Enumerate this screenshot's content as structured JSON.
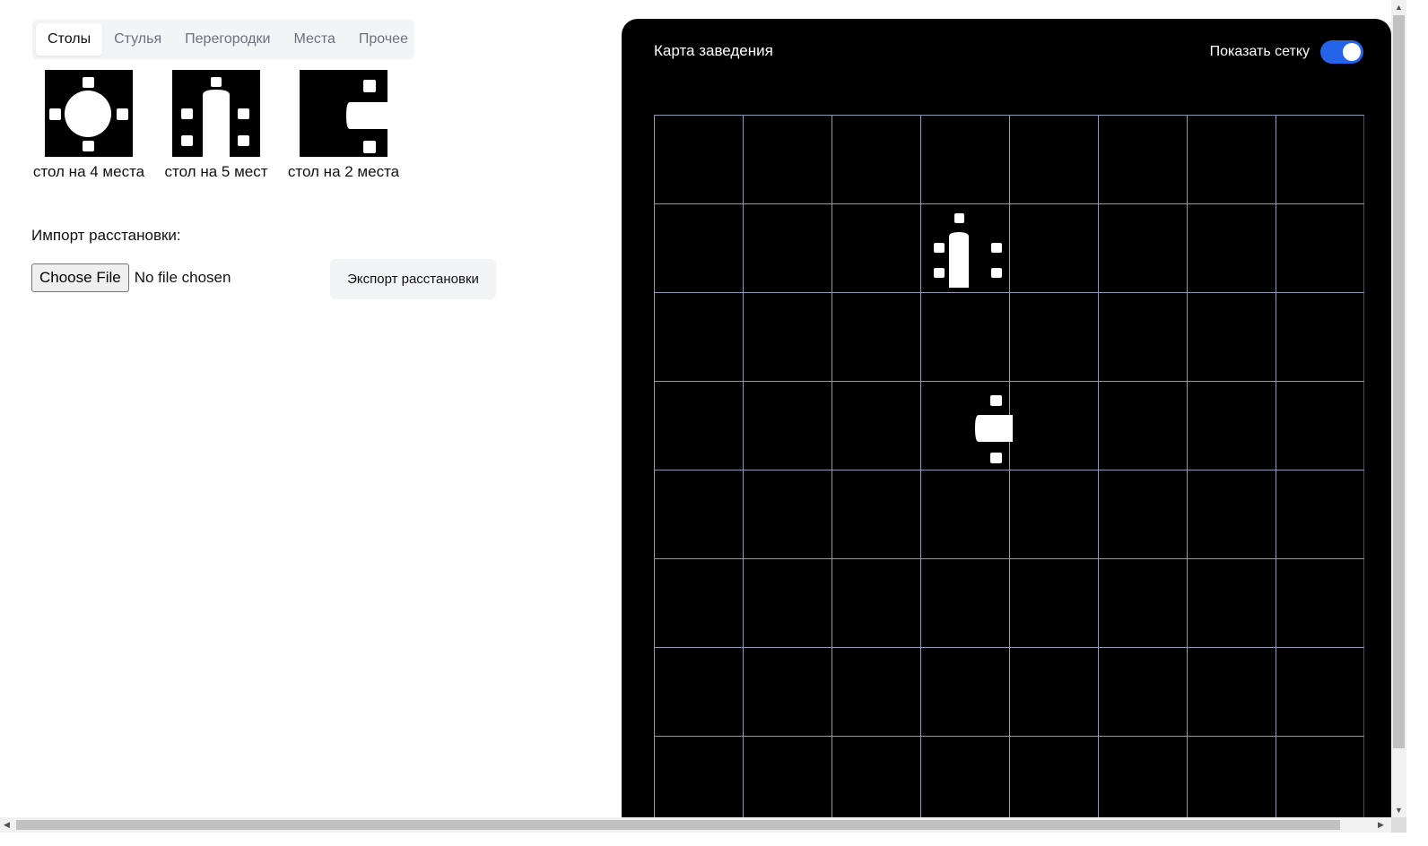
{
  "tabs": [
    {
      "label": "Столы",
      "active": true
    },
    {
      "label": "Стулья",
      "active": false
    },
    {
      "label": "Перегородки",
      "active": false
    },
    {
      "label": "Места",
      "active": false
    },
    {
      "label": "Прочее",
      "active": false
    }
  ],
  "items": [
    {
      "label": "стол на 4 места",
      "icon": "round-table-4-icon"
    },
    {
      "label": "стол на 5 мест",
      "icon": "long-table-5-icon"
    },
    {
      "label": "стол на 2 места",
      "icon": "side-table-2-icon"
    }
  ],
  "import": {
    "label": "Импорт расстановки:",
    "choose_button": "Choose File",
    "file_status": "No file chosen"
  },
  "export": {
    "button": "Экспорт расстановки"
  },
  "map": {
    "title": "Карта заведения",
    "show_grid_label": "Показать сетку",
    "show_grid": true,
    "grid_columns": 8,
    "grid_rows_visible": 8,
    "placed_items": [
      {
        "type": "long-table-5",
        "column": 4,
        "row": 2
      },
      {
        "type": "side-table-2",
        "column": 4,
        "row": 4
      }
    ]
  },
  "colors": {
    "accent": "#2563eb",
    "map_background": "#000000",
    "grid_line": "#8c9bb5",
    "tab_bar": "#f3f4f6"
  }
}
